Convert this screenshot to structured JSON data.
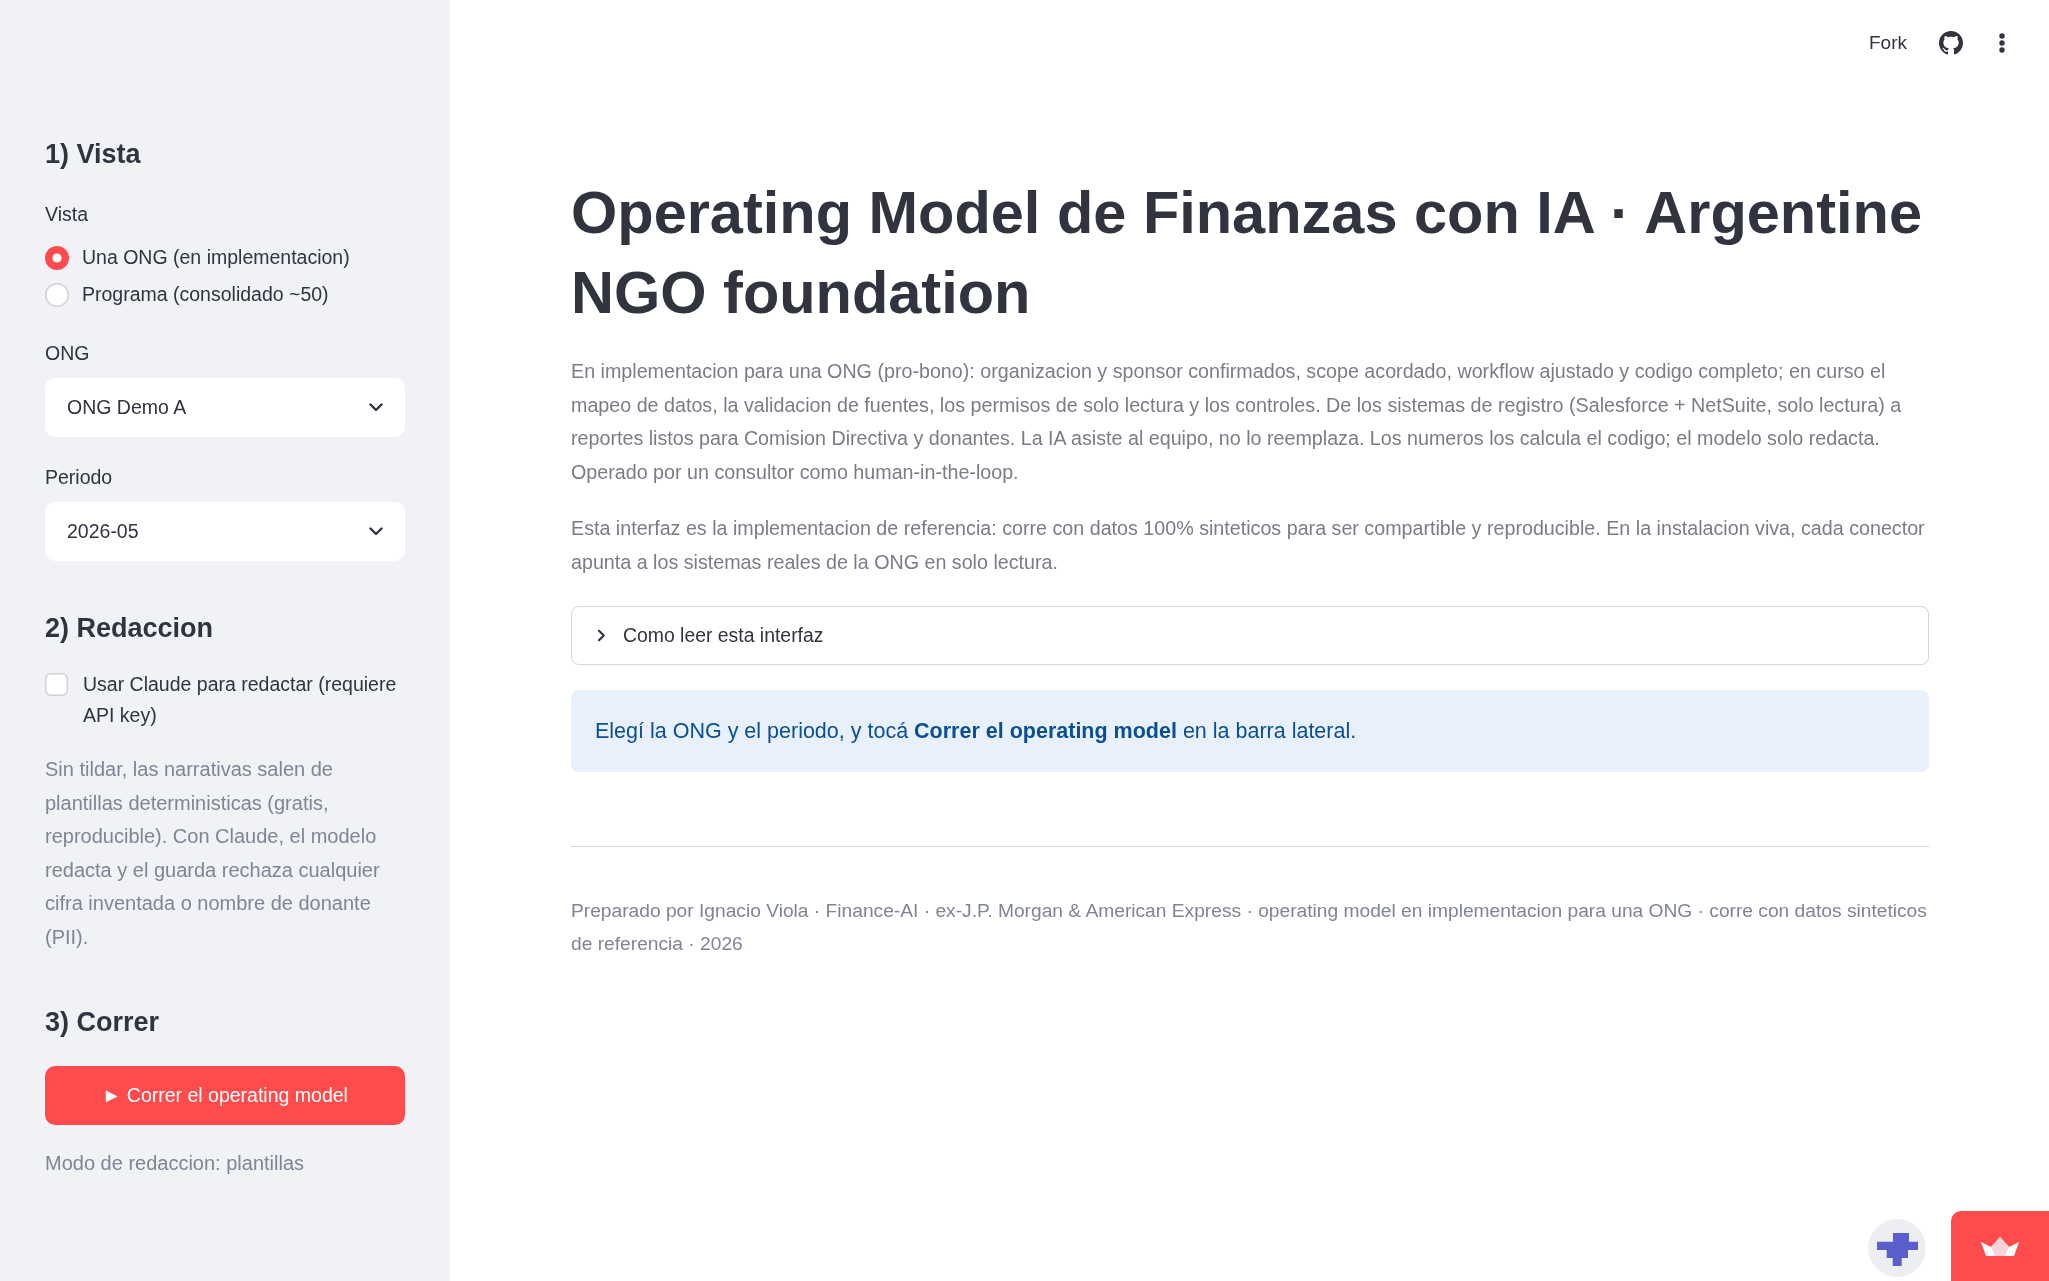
{
  "header": {
    "fork_label": "Fork"
  },
  "sidebar": {
    "items": [
      {
        "kind": "heading",
        "text": "1) Vista"
      },
      {
        "kind": "radio",
        "label": "Vista",
        "options": [
          {
            "label": "Una ONG (en implementacion)",
            "selected": true
          },
          {
            "label": "Programa (consolidado ~50)",
            "selected": false
          }
        ]
      },
      {
        "kind": "select",
        "label": "ONG",
        "value": "ONG Demo A"
      },
      {
        "kind": "select",
        "label": "Periodo",
        "value": "2026-05"
      },
      {
        "kind": "heading",
        "text": "2) Redaccion"
      },
      {
        "kind": "checkbox",
        "label": "Usar Claude para redactar (requiere API key)",
        "checked": false
      },
      {
        "kind": "caption",
        "text": "Sin tildar, las narrativas salen de plantillas deterministicas (gratis, reproducible). Con Claude, el modelo redacta y el guarda rechaza cualquier cifra inventada o nombre de donante (PII)."
      },
      {
        "kind": "heading",
        "text": "3) Correr"
      },
      {
        "kind": "button",
        "label": "► Correr el operating model"
      },
      {
        "kind": "caption",
        "text": "Modo de redaccion: plantillas"
      }
    ]
  },
  "main": {
    "title": "Operating Model de Finanzas con IA · Argentine NGO foundation",
    "paragraphs": [
      "En implementacion para una ONG (pro-bono): organizacion y sponsor confirmados, scope acordado, workflow ajustado y codigo completo; en curso el mapeo de datos, la validacion de fuentes, los permisos de solo lectura y los controles. De los sistemas de registro (Salesforce + NetSuite, solo lectura) a reportes listos para Comision Directiva y donantes. La IA asiste al equipo, no lo reemplaza. Los numeros los calcula el codigo; el modelo solo redacta. Operado por un consultor como human-in-the-loop.",
      "Esta interfaz es la implementacion de referencia: corre con datos 100% sinteticos para ser compartible y reproducible. En la instalacion viva, cada conector apunta a los sistemas reales de la ONG en solo lectura."
    ],
    "expander": {
      "label": "Como leer esta interfaz",
      "expanded": false
    },
    "info": "Elegí la ONG y el periodo, y tocá **Correr el operating model** en la barra lateral.",
    "footer": "Preparado por Ignacio Viola · Finance-AI · ex-J.P. Morgan & American Express · operating model en implementacion para una ONG · corre con datos sinteticos de referencia · 2026"
  }
}
